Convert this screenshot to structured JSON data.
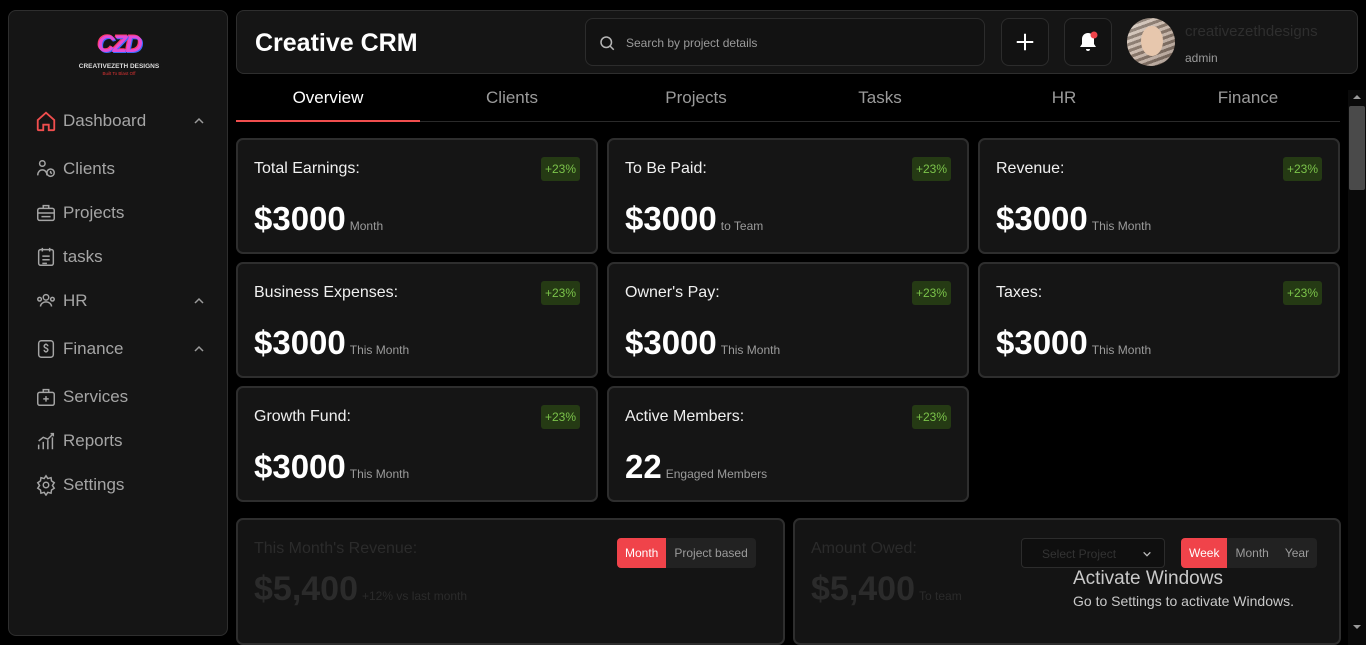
{
  "logo": {
    "mark": "CZD",
    "brand": "CREATIVEZETH DESIGNS",
    "tagline": "Built To Blast Off"
  },
  "sidebar": {
    "items": [
      {
        "label": "Dashboard",
        "icon": "home-icon"
      },
      {
        "label": "Clients",
        "icon": "clients-icon"
      },
      {
        "label": "Projects",
        "icon": "briefcase-icon"
      },
      {
        "label": "tasks",
        "icon": "calendar-list-icon"
      },
      {
        "label": "HR",
        "icon": "people-icon"
      },
      {
        "label": "Finance",
        "icon": "dollar-icon"
      },
      {
        "label": "Services",
        "icon": "bag-plus-icon"
      },
      {
        "label": "Reports",
        "icon": "chart-icon"
      },
      {
        "label": "Settings",
        "icon": "gear-icon"
      }
    ]
  },
  "header": {
    "title": "Creative CRM",
    "search_placeholder": "Search by project details",
    "user_name": "creativezethdesigns",
    "user_role": "admin",
    "notification_dot_color": "#f0434a"
  },
  "tabs": [
    "Overview",
    "Clients",
    "Projects",
    "Tasks",
    "HR",
    "Finance"
  ],
  "cards": [
    {
      "label": "Total Earnings:",
      "badge": "+23%",
      "value": "$3000",
      "sub": "Month"
    },
    {
      "label": "To Be Paid:",
      "badge": "+23%",
      "value": "$3000",
      "sub": "to Team"
    },
    {
      "label": "Revenue:",
      "badge": "+23%",
      "value": "$3000",
      "sub": "This Month"
    },
    {
      "label": "Business Expenses:",
      "badge": "+23%",
      "value": "$3000",
      "sub": "This Month"
    },
    {
      "label": "Owner's Pay:",
      "badge": "+23%",
      "value": "$3000",
      "sub": "This Month"
    },
    {
      "label": "Taxes:",
      "badge": "+23%",
      "value": "$3000",
      "sub": "This Month"
    },
    {
      "label": "Growth Fund:",
      "badge": "+23%",
      "value": "$3000",
      "sub": "This Month"
    },
    {
      "label": "Active Members:",
      "badge": "+23%",
      "value": "22",
      "sub": "Engaged Members"
    }
  ],
  "revenue_panel": {
    "title": "This Month's Revenue:",
    "value": "$5,400",
    "sub": "+12% vs last month",
    "toggle": [
      "Month",
      "Project based"
    ]
  },
  "owed_panel": {
    "title": "Amount Owed:",
    "value": "$5,400",
    "sub": "To team",
    "select_placeholder": "Select Project",
    "toggle": [
      "Week",
      "Month",
      "Year"
    ]
  },
  "watermark": {
    "line1": "Activate Windows",
    "line2": "Go to Settings to activate Windows."
  },
  "colors": {
    "accent": "#f04e4e",
    "badge_bg": "#253a14",
    "badge_text": "#7bc34a"
  }
}
